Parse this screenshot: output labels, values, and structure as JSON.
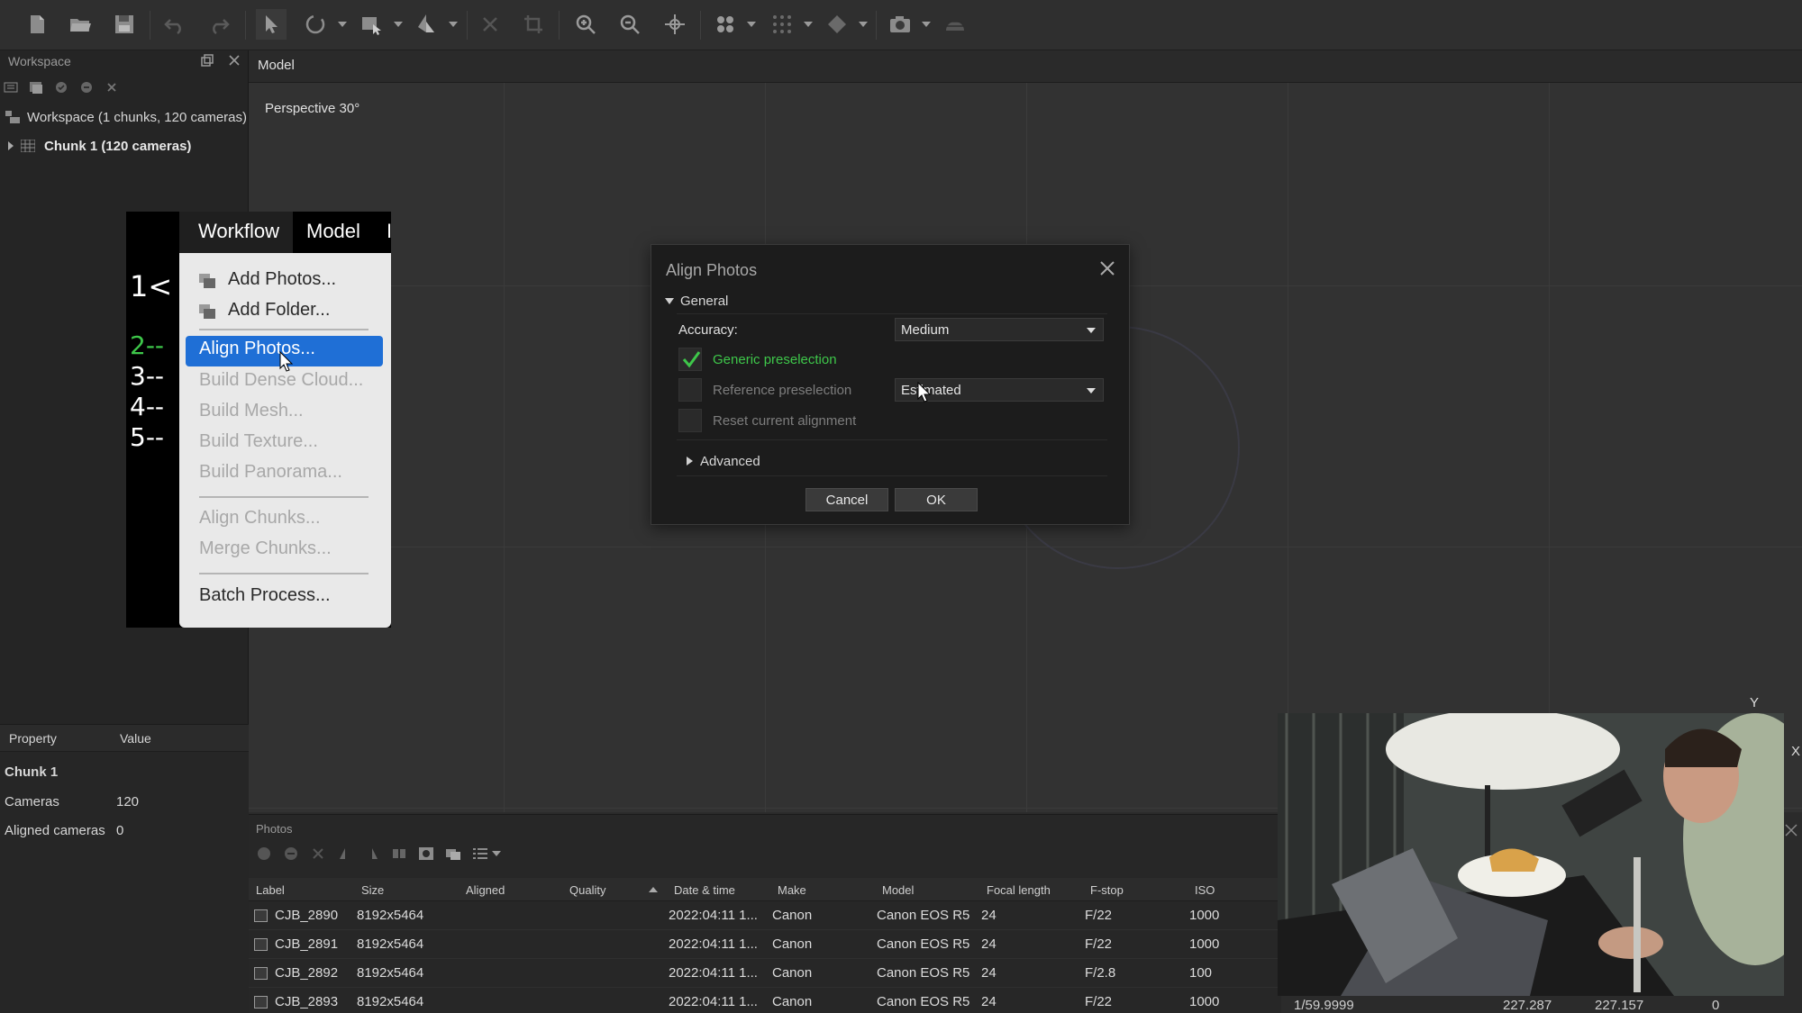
{
  "toolbar": {
    "icons": [
      "new-document-icon",
      "open-folder-icon",
      "save-icon",
      "undo-icon",
      "redo-icon",
      "select-arrow-icon",
      "rotate-object-icon",
      "selection-rectangle-icon",
      "navigation-icon",
      "delete-icon",
      "crop-icon",
      "zoom-in-icon",
      "zoom-out-icon",
      "move-object-icon",
      "point-cloud-icon",
      "dense-cloud-icon",
      "model-shading-icon",
      "camera-icon",
      "tiled-model-icon"
    ]
  },
  "workspace": {
    "title": "Workspace",
    "root_label": "Workspace (1 chunks, 120 cameras)",
    "chunk_label": "Chunk 1 (120 cameras)"
  },
  "properties": {
    "col_property": "Property",
    "col_value": "Value",
    "section": "Chunk 1",
    "rows": [
      {
        "name": "Cameras",
        "value": "120"
      },
      {
        "name": "Aligned cameras",
        "value": "0"
      }
    ]
  },
  "model": {
    "tab": "Model",
    "view_label": "Perspective 30°"
  },
  "menu_overlay": {
    "menubar": [
      "Workflow",
      "Model",
      "I"
    ],
    "steps": [
      "1<",
      "2--",
      "3--",
      "4--",
      "5--"
    ],
    "step_colors": {
      "2--": "#3ec74a"
    },
    "items": [
      {
        "label": "Add Photos...",
        "enabled": true
      },
      {
        "label": "Add Folder...",
        "enabled": true
      },
      {
        "label": "Align Photos...",
        "enabled": true,
        "selected": true
      },
      {
        "label": "Build Dense Cloud...",
        "enabled": false
      },
      {
        "label": "Build Mesh...",
        "enabled": false
      },
      {
        "label": "Build Texture...",
        "enabled": false
      },
      {
        "label": "Build Panorama...",
        "enabled": false
      },
      {
        "label": "Align Chunks...",
        "enabled": false
      },
      {
        "label": "Merge Chunks...",
        "enabled": false
      },
      {
        "label": "Batch Process...",
        "enabled": true
      }
    ],
    "accent": "#1f6fd6"
  },
  "dialog": {
    "title": "Align Photos",
    "general": "General",
    "accuracy_label": "Accuracy:",
    "accuracy_value": "Medium",
    "generic_preselection": "Generic preselection",
    "generic_checked": true,
    "reference_preselection": "Reference preselection",
    "reference_value": "Estimated",
    "reset_alignment": "Reset current alignment",
    "advanced": "Advanced",
    "cancel": "Cancel",
    "ok": "OK",
    "check_color": "#3ec74a"
  },
  "photos": {
    "title": "Photos",
    "columns": [
      "Label",
      "Size",
      "Aligned",
      "Quality",
      "Date & time",
      "Make",
      "Model",
      "Focal length",
      "F-stop",
      "ISO"
    ],
    "rows": [
      {
        "label": "CJB_2890",
        "size": "8192x5464",
        "aligned": "",
        "quality": "",
        "date": "2022:04:11 1...",
        "make": "Canon",
        "model": "Canon EOS R5",
        "focal": "24",
        "fstop": "F/22",
        "iso": "1000"
      },
      {
        "label": "CJB_2891",
        "size": "8192x5464",
        "aligned": "",
        "quality": "",
        "date": "2022:04:11 1...",
        "make": "Canon",
        "model": "Canon EOS R5",
        "focal": "24",
        "fstop": "F/22",
        "iso": "1000"
      },
      {
        "label": "CJB_2892",
        "size": "8192x5464",
        "aligned": "",
        "quality": "",
        "date": "2022:04:11 1...",
        "make": "Canon",
        "model": "Canon EOS R5",
        "focal": "24",
        "fstop": "F/2.8",
        "iso": "100"
      },
      {
        "label": "CJB_2893",
        "size": "8192x5464",
        "aligned": "",
        "quality": "",
        "date": "2022:04:11 1...",
        "make": "Canon",
        "model": "Canon EOS R5",
        "focal": "24",
        "fstop": "F/22",
        "iso": "1000"
      }
    ],
    "extra_row_values": [
      "1/59.9999",
      "227.287",
      "227.157",
      "0"
    ]
  },
  "edge_labels": {
    "y": "Y",
    "x": "X",
    "x2": "X"
  }
}
